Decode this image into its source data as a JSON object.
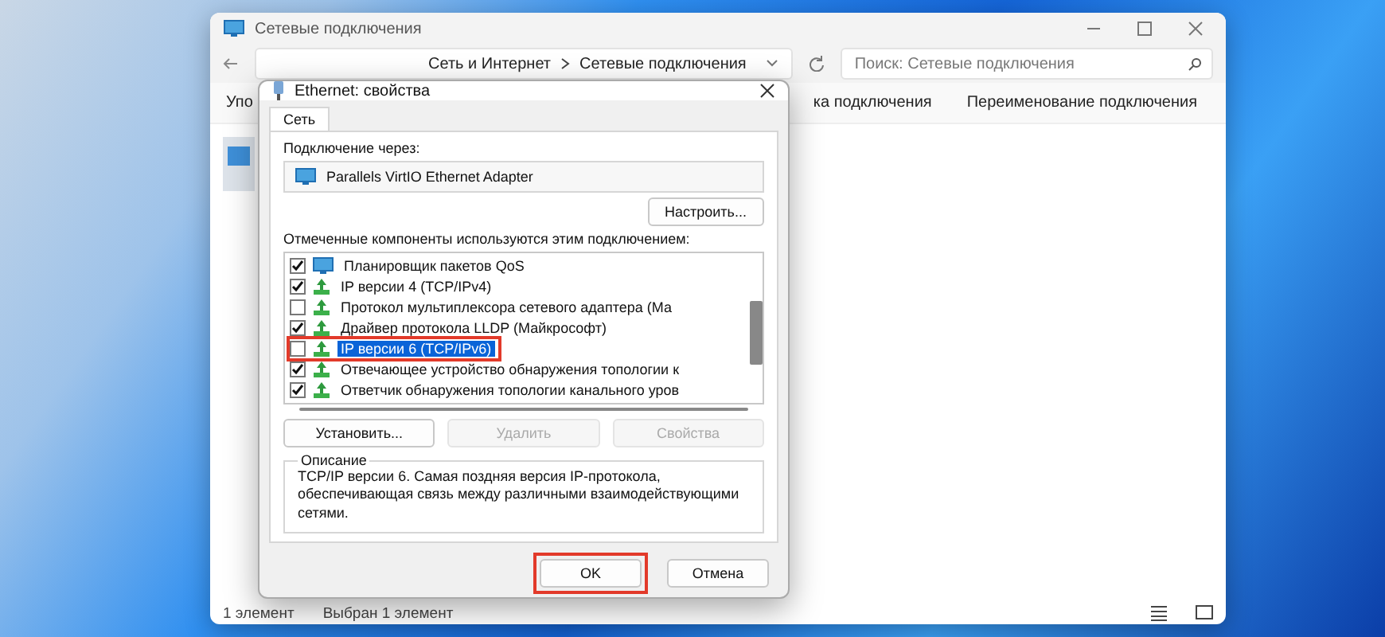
{
  "explorer": {
    "title": "Сетевые подключения",
    "breadcrumb": [
      "Сеть и Интернет",
      "Сетевые подключения"
    ],
    "search": {
      "placeholder": "Поиск: Сетевые подключения"
    },
    "commands": [
      "Упо",
      "ка подключения",
      "Переименование подключения"
    ],
    "status": [
      "1 элемент",
      "Выбран 1 элемент"
    ]
  },
  "dialog": {
    "title": "Ethernet: свойства",
    "tabs": [
      {
        "label": "Сеть",
        "selected": true
      }
    ],
    "connect_label": "Подключение через:",
    "adapter": "Parallels VirtIO Ethernet Adapter",
    "configure_button": "Настроить...",
    "components_label": "Отмеченные компоненты используются этим подключением:",
    "components": [
      {
        "kind": "service",
        "label": "Планировщик пакетов QoS",
        "checked": true,
        "selected": false,
        "highlighted": false
      },
      {
        "kind": "protocol",
        "label": "IP версии 4 (TCP/IPv4)",
        "checked": true,
        "selected": false,
        "highlighted": false
      },
      {
        "kind": "protocol",
        "label": "Протокол мультиплексора сетевого адаптера (Ма",
        "checked": false,
        "selected": false,
        "highlighted": false
      },
      {
        "kind": "protocol",
        "label": "Драйвер протокола LLDP (Майкрософт)",
        "checked": true,
        "selected": false,
        "highlighted": false
      },
      {
        "kind": "protocol",
        "label": "IP версии 6 (TCP/IPv6)",
        "checked": false,
        "selected": true,
        "highlighted": true
      },
      {
        "kind": "protocol",
        "label": "Отвечающее устройство обнаружения топологии к",
        "checked": true,
        "selected": false,
        "highlighted": false
      },
      {
        "kind": "protocol",
        "label": "Ответчик обнаружения топологии канального уров",
        "checked": true,
        "selected": false,
        "highlighted": false
      }
    ],
    "buttons": [
      {
        "label": "Установить...",
        "disabled": false
      },
      {
        "label": "Удалить",
        "disabled": true
      },
      {
        "label": "Свойства",
        "disabled": true
      }
    ],
    "description": {
      "title": "Описание",
      "text": "TCP/IP версии 6. Самая поздняя версия IP-протокола, обеспечивающая связь между различными взаимодействующими сетями."
    },
    "footer_buttons": [
      {
        "label": "OK",
        "highlighted": true
      },
      {
        "label": "Отмена",
        "highlighted": false
      }
    ]
  }
}
